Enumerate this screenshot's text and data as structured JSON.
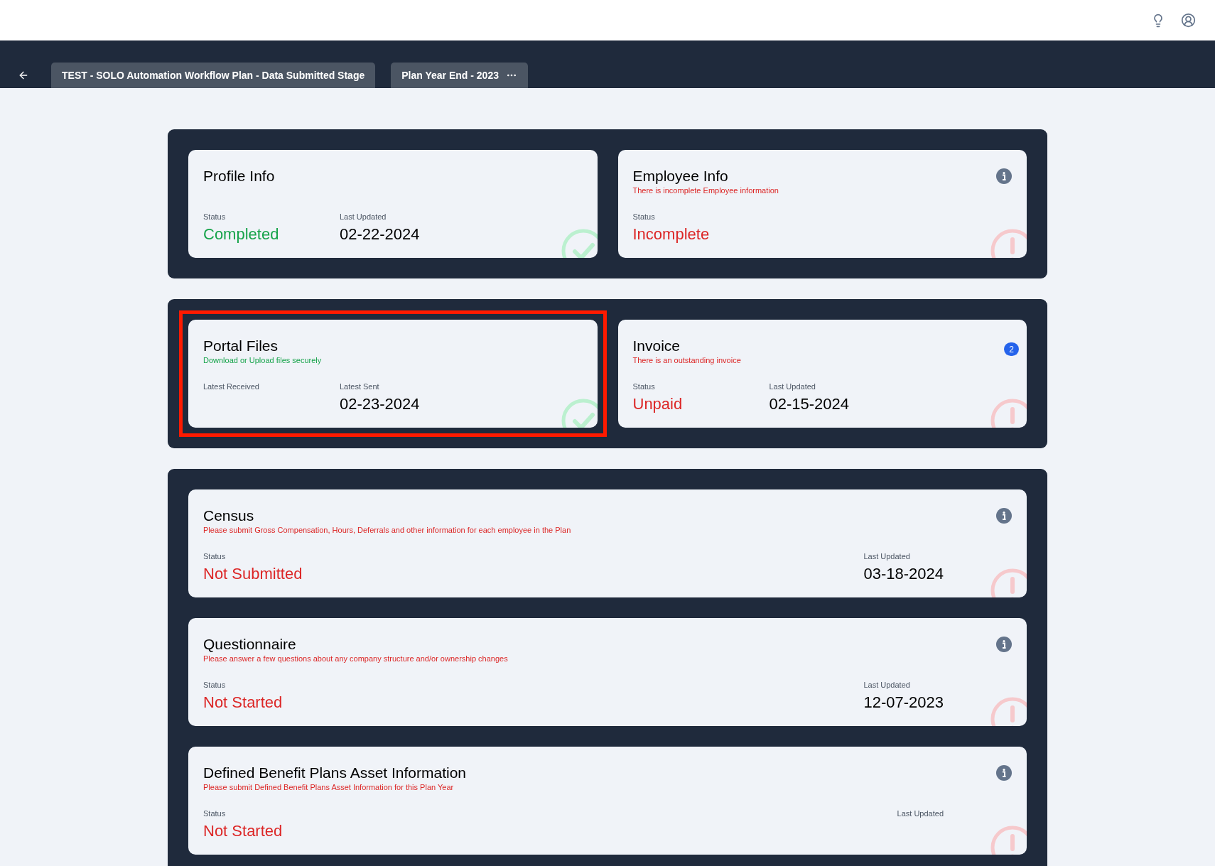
{
  "tabs": [
    {
      "label": "TEST - SOLO Automation Workflow Plan - Data Submitted Stage",
      "menu": false
    },
    {
      "label": "Plan Year End - 2023",
      "menu": true
    }
  ],
  "panels": [
    {
      "kind": "pair",
      "cards": [
        {
          "title": "Profile Info",
          "kind": "success",
          "highlighted": false,
          "info": false,
          "fields": [
            {
              "label": "Status",
              "kind": "status",
              "value": "Completed"
            },
            {
              "label": "Last Updated",
              "kind": "date",
              "value": "02-22-2024"
            }
          ]
        },
        {
          "title": "Employee Info",
          "subtitle": "There is incomplete Employee information",
          "kind": "danger",
          "highlighted": false,
          "info": true,
          "fields": [
            {
              "label": "Status",
              "kind": "status",
              "value": "Incomplete"
            }
          ]
        }
      ]
    },
    {
      "kind": "pair",
      "cards": [
        {
          "title": "Portal Files",
          "subtitle": "Download or Upload files securely",
          "kind": "success",
          "highlighted": true,
          "info": false,
          "fields": [
            {
              "label": "Latest Received",
              "kind": "date"
            },
            {
              "label": "Latest Sent",
              "kind": "date",
              "value": "02-23-2024"
            }
          ]
        },
        {
          "title": "Invoice",
          "subtitle": "There is an outstanding invoice",
          "kind": "danger",
          "highlighted": false,
          "info": false,
          "badge": "2",
          "fields": [
            {
              "label": "Status",
              "kind": "status",
              "value": "Unpaid"
            },
            {
              "label": "Last Updated",
              "kind": "date",
              "value": "02-15-2024"
            }
          ]
        }
      ]
    },
    {
      "kind": "stack",
      "cards": [
        {
          "title": "Census",
          "subtitle": "Please submit Gross Compensation, Hours, Deferrals and other information for each employee in the Plan",
          "kind": "danger",
          "highlighted": false,
          "info": true,
          "fields": [
            {
              "label": "Status",
              "kind": "status",
              "value": "Not Submitted"
            },
            {
              "label": "Last Updated",
              "kind": "date",
              "value": "03-18-2024"
            }
          ]
        },
        {
          "title": "Questionnaire",
          "subtitle": "Please answer a few questions about any company structure and/or ownership changes",
          "kind": "danger",
          "highlighted": false,
          "info": true,
          "fields": [
            {
              "label": "Status",
              "kind": "status",
              "value": "Not Started"
            },
            {
              "label": "Last Updated",
              "kind": "date",
              "value": "12-07-2023"
            }
          ]
        },
        {
          "title": "Defined Benefit Plans Asset Information",
          "subtitle": "Please submit Defined Benefit Plans Asset Information for this Plan Year",
          "kind": "danger",
          "highlighted": false,
          "info": true,
          "fields": [
            {
              "label": "Status",
              "kind": "status",
              "value": "Not Started"
            },
            {
              "label": "Last Updated",
              "kind": "date"
            }
          ]
        }
      ]
    }
  ]
}
